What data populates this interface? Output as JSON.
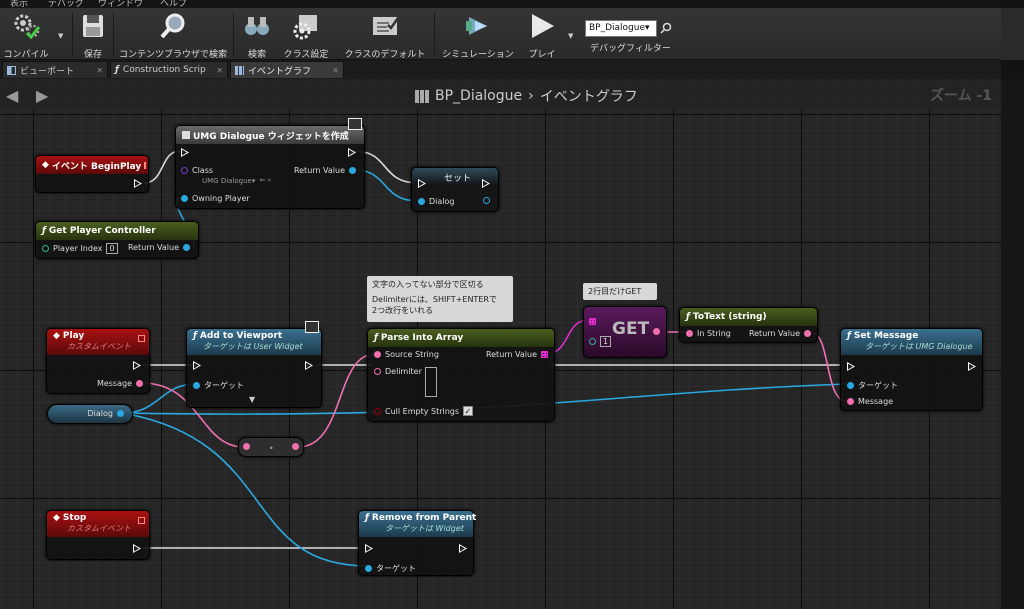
{
  "menubar": {
    "items": [
      "表示",
      "デバッグ",
      "ウィンドウ",
      "ヘルプ"
    ]
  },
  "toolbar": {
    "compile": "コンパイル",
    "save": "保存",
    "browse": "コンテンツブラウザで検索",
    "search": "検索",
    "class_settings": "クラス設定",
    "class_defaults": "クラスのデフォルト",
    "simulation": "シミュレーション",
    "play": "プレイ",
    "debug_filter_value": "BP_Dialogue▾",
    "debug_filter_label": "デバッグフィルター"
  },
  "tabs": [
    {
      "label": "ビューポート"
    },
    {
      "label": "Construction Scrip"
    },
    {
      "label": "イベントグラフ"
    }
  ],
  "breadcrumb": {
    "blueprint": "BP_Dialogue",
    "separator": "›",
    "graph": "イベントグラフ"
  },
  "zoom": "ズーム -1",
  "nodes": {
    "begin_play": {
      "title": "イベント BeginPlay"
    },
    "create_widget": {
      "title": "UMG Dialogue ウィジェットを作成",
      "class_label": "Class",
      "class_value": "UMG Dialogue▾",
      "return_value": "Return Value",
      "owning_player": "Owning Player"
    },
    "set_node": {
      "title": "セット",
      "dialog": "Dialog"
    },
    "get_player_controller": {
      "title": "Get Player Controller",
      "player_index": "Player Index",
      "player_index_value": "0",
      "return_value": "Return Value"
    },
    "play_event": {
      "title": "Play",
      "subtitle": "カスタムイベント",
      "message": "Message"
    },
    "add_to_viewport": {
      "title": "Add to Viewport",
      "subtitle": "ターゲットは User Widget",
      "target": "ターゲット"
    },
    "dialog_var": {
      "label": "Dialog"
    },
    "parse_into_array": {
      "title": "Parse Into Array",
      "source": "Source String",
      "return_value": "Return Value",
      "delimiter": "Delimiter",
      "cull": "Cull Empty Strings"
    },
    "get_node": {
      "title": "GET",
      "index": "1"
    },
    "to_text": {
      "title": "ToText (string)",
      "in_string": "In String",
      "return_value": "Return Value"
    },
    "set_message": {
      "title": "Set Message",
      "subtitle": "ターゲットは UMG Dialogue",
      "target": "ターゲット",
      "message": "Message"
    },
    "stop_event": {
      "title": "Stop",
      "subtitle": "カスタムイベント"
    },
    "remove_from_parent": {
      "title": "Remove from Parent",
      "subtitle": "ターゲットは Widget",
      "target": "ターゲット"
    }
  },
  "comments": {
    "parse_comment_line1": "文字の入ってない部分で区切る",
    "parse_comment_line2": "Delimiterには、SHIFT+ENTERで",
    "parse_comment_line3": "2つ改行をいれる",
    "get_comment": "2行目だけGET"
  },
  "colors": {
    "event_red": "#a11111",
    "function_green": "#4a5e1f",
    "target_blue": "#3a7090",
    "object_pin": "#2aa8e0",
    "string_pin": "#f070b0",
    "array_pin": "#e02ad0"
  }
}
